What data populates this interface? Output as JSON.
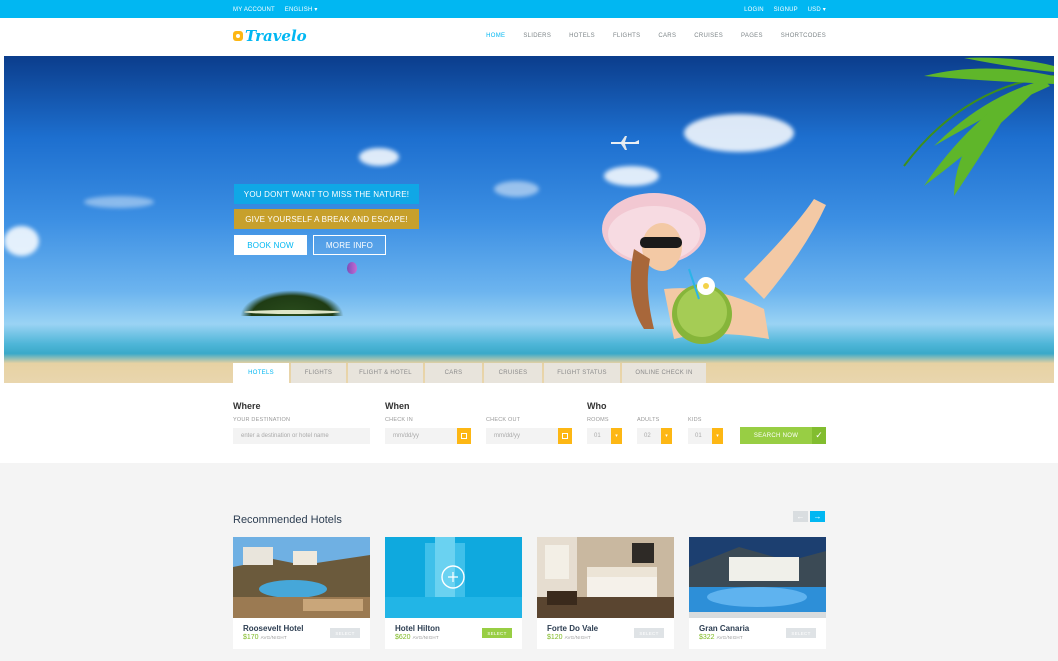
{
  "topbar": {
    "left": [
      "MY ACCOUNT",
      "ENGLISH ▾"
    ],
    "right": [
      "LOGIN",
      "SIGNUP",
      "USD ▾"
    ]
  },
  "header": {
    "logo": "Travelo",
    "nav": [
      "HOME",
      "SLIDERS",
      "HOTELS",
      "FLIGHTS",
      "CARS",
      "CRUISES",
      "PAGES",
      "SHORTCODES"
    ]
  },
  "hero": {
    "promo1": "YOU DON'T WANT TO MISS THE NATURE!",
    "promo2": "GIVE YOURSELF A BREAK AND ESCAPE!",
    "book_now": "BOOK NOW",
    "more_info": "MORE INFO"
  },
  "tabs": [
    "HOTELS",
    "FLIGHTS",
    "FLIGHT & HOTEL",
    "CARS",
    "CRUISES",
    "FLIGHT STATUS",
    "ONLINE CHECK IN"
  ],
  "search": {
    "where_title": "Where",
    "destination_label": "YOUR DESTINATION",
    "destination_placeholder": "enter a destination or hotel name",
    "when_title": "When",
    "checkin_label": "CHECK IN",
    "checkout_label": "CHECK OUT",
    "date_placeholder": "mm/dd/yy",
    "who_title": "Who",
    "rooms_label": "ROOMS",
    "adults_label": "ADULTS",
    "kids_label": "KIDS",
    "rooms_value": "01",
    "adults_value": "02",
    "kids_value": "01",
    "search_button": "SEARCH NOW"
  },
  "recommended": {
    "title": "Recommended Hotels",
    "hotels": [
      {
        "name": "Roosevelt Hotel",
        "price": "$170",
        "unit": "AVG/NIGHT",
        "select": "SELECT"
      },
      {
        "name": "Hotel Hilton",
        "price": "$620",
        "unit": "AVG/NIGHT",
        "select": "SELECT"
      },
      {
        "name": "Forte Do Vale",
        "price": "$120",
        "unit": "AVG/NIGHT",
        "select": "SELECT"
      },
      {
        "name": "Gran Canaria",
        "price": "$322",
        "unit": "AVG/NIGHT",
        "select": "SELECT"
      }
    ]
  },
  "colors": {
    "accent": "#01b7f2",
    "yellow": "#fdb714",
    "green": "#98ce44"
  }
}
